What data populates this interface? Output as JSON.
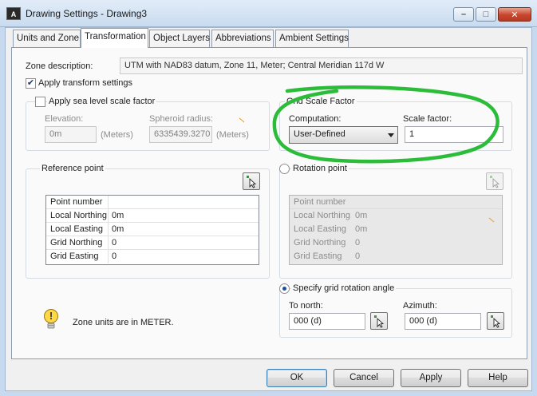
{
  "window": {
    "title": "Drawing Settings - Drawing3",
    "app_icon_text": "A",
    "minimize_glyph": "–",
    "maximize_glyph": "□",
    "close_glyph": "✕"
  },
  "tabs": [
    {
      "label": "Units and Zone",
      "active": false
    },
    {
      "label": "Transformation",
      "active": true
    },
    {
      "label": "Object Layers",
      "active": false
    },
    {
      "label": "Abbreviations",
      "active": false
    },
    {
      "label": "Ambient Settings",
      "active": false
    }
  ],
  "zone_description": {
    "label": "Zone description:",
    "value": "UTM with NAD83 datum, Zone 11, Meter; Central Meridian 117d W"
  },
  "apply_transform": {
    "label": "Apply transform settings",
    "checked": true,
    "check_glyph": "✔"
  },
  "sea_level": {
    "label": "Apply sea level scale factor",
    "checked": false,
    "elevation_label": "Elevation:",
    "elevation_value": "0m",
    "elevation_units": "(Meters)",
    "spheroid_label": "Spheroid radius:",
    "spheroid_value": "6335439.3270",
    "spheroid_units": "(Meters)"
  },
  "grid_scale": {
    "title": "Grid Scale Factor",
    "computation_label": "Computation:",
    "computation_value": "User-Defined",
    "scale_label": "Scale factor:",
    "scale_value": "1"
  },
  "reference_point": {
    "title": "Reference point",
    "rows": [
      {
        "label": "Point number",
        "value": ""
      },
      {
        "label": "Local Northing",
        "value": "0m"
      },
      {
        "label": "Local Easting",
        "value": "0m"
      },
      {
        "label": "Grid Northing",
        "value": "0"
      },
      {
        "label": "Grid Easting",
        "value": "0"
      }
    ]
  },
  "rotation_point": {
    "title": "Rotation point",
    "selected": false,
    "rows": [
      {
        "label": "Point number",
        "value": ""
      },
      {
        "label": "Local Northing",
        "value": "0m"
      },
      {
        "label": "Local Easting",
        "value": "0m"
      },
      {
        "label": "Grid Northing",
        "value": "0"
      },
      {
        "label": "Grid Easting",
        "value": "0"
      }
    ]
  },
  "grid_rotation": {
    "title": "Specify grid rotation angle",
    "selected": true,
    "to_north_label": "To north:",
    "to_north_value": "000 (d)",
    "azimuth_label": "Azimuth:",
    "azimuth_value": "000 (d)"
  },
  "info": {
    "text": "Zone units are in METER.",
    "icon_glyph": "!"
  },
  "buttons": {
    "ok": "OK",
    "cancel": "Cancel",
    "apply": "Apply",
    "help": "Help"
  },
  "annotation": {
    "color": "#2bbd3a"
  }
}
